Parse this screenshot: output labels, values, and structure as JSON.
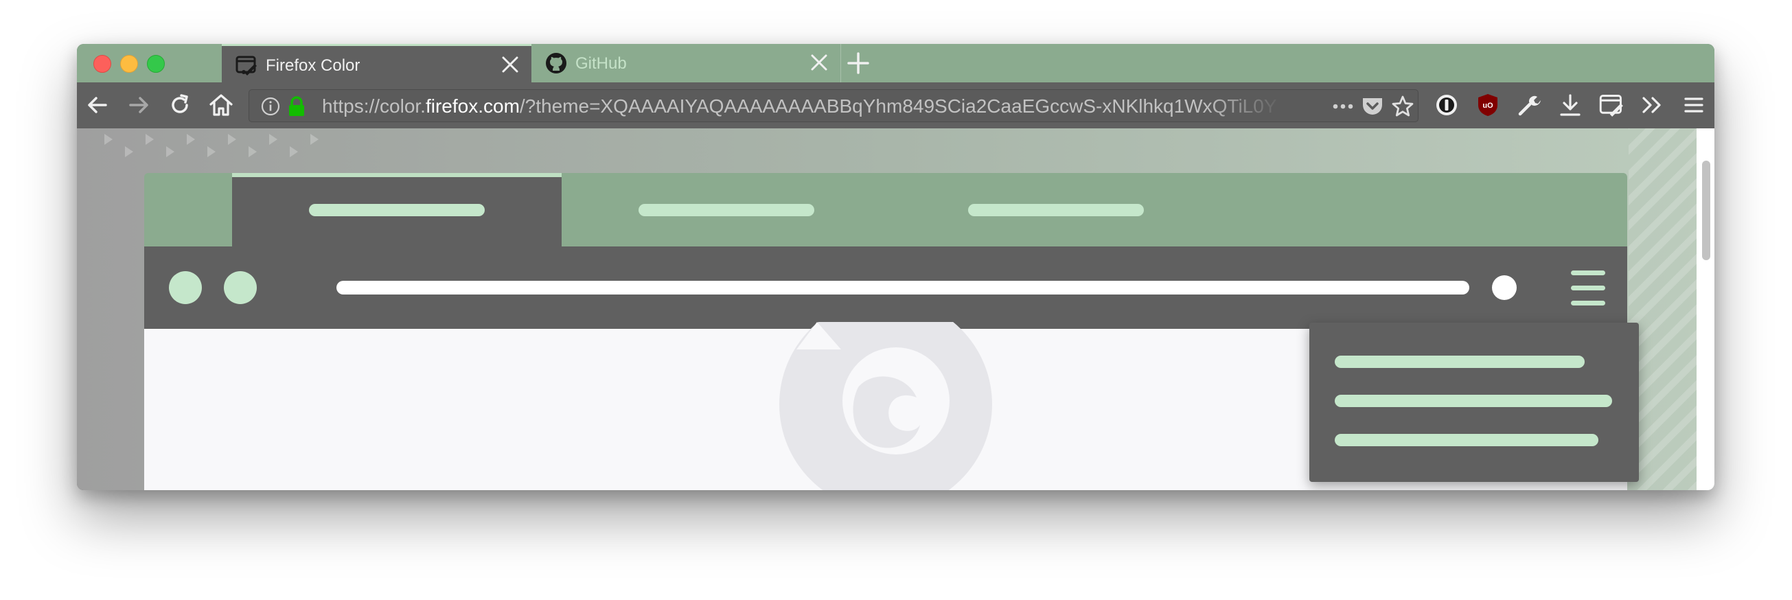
{
  "window": {
    "controls": [
      "close",
      "minimize",
      "zoom"
    ]
  },
  "tabs": [
    {
      "title": "Firefox Color",
      "active": true,
      "icon": "firefox-color-icon"
    },
    {
      "title": "GitHub",
      "active": false,
      "icon": "github-icon"
    }
  ],
  "navbar": {
    "url_prefix": "https://color.",
    "url_host": "firefox.com",
    "url_rest": "/?theme=XQAAAAIYAQAAAAAAAABBqYhm849SCia2CaaEGccwS-xNKlhkq1WxQTiL0Y",
    "icons": [
      "back-icon",
      "forward-icon",
      "reload-icon",
      "home-icon",
      "info-icon",
      "lock-icon",
      "page-actions-icon",
      "pocket-icon",
      "bookmark-star-icon",
      "1password-icon",
      "ublock-icon",
      "devtools-wrench-icon",
      "downloads-icon",
      "firefox-color-icon",
      "overflow-chevron-icon",
      "hamburger-menu-icon"
    ]
  },
  "colors": {
    "frame": "#8bab8f",
    "toolbar": "#606060",
    "accent": "#c5e7cb",
    "text_active": "#f0f0f0",
    "text_inactive": "#c5e2c8",
    "lock": "#12bc00"
  }
}
